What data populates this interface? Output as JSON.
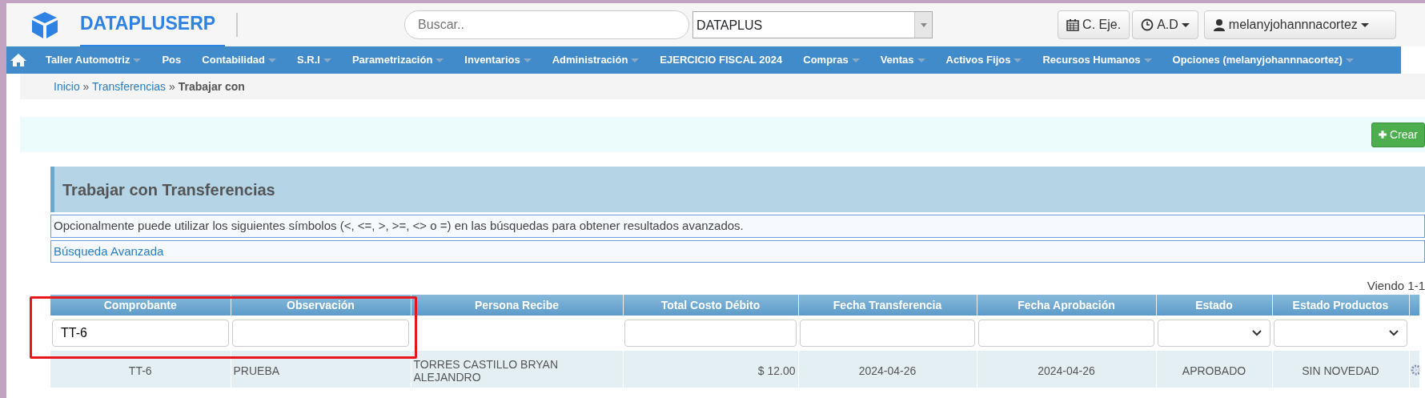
{
  "header": {
    "logo": "DATAPLUSERP",
    "search": {
      "placeholder": "Buscar.."
    },
    "company_select": {
      "value": "DATAPLUS"
    },
    "buttons": [
      {
        "label": "C. Eje.",
        "kind": "calendar",
        "caret": false
      },
      {
        "label": "A.D",
        "kind": "clock",
        "caret": true
      },
      {
        "label": "melanyjohannnacortez",
        "kind": "user",
        "caret": true
      }
    ]
  },
  "menu": [
    {
      "label": "Taller Automotriz",
      "dropdown": true
    },
    {
      "label": "Pos",
      "dropdown": false
    },
    {
      "label": "Contabilidad",
      "dropdown": true
    },
    {
      "label": "S.R.I",
      "dropdown": true
    },
    {
      "label": "Parametrización",
      "dropdown": true
    },
    {
      "label": "Inventarios",
      "dropdown": true
    },
    {
      "label": "Administración",
      "dropdown": true
    },
    {
      "label": "EJERCICIO FISCAL 2024",
      "dropdown": false
    },
    {
      "label": "Compras",
      "dropdown": true
    },
    {
      "label": "Ventas",
      "dropdown": true
    },
    {
      "label": "Activos Fijos",
      "dropdown": true
    },
    {
      "label": "Recursos Humanos",
      "dropdown": true
    },
    {
      "label": "Opciones (melanyjohannnacortez)",
      "dropdown": true
    }
  ],
  "breadcrumb": {
    "separator": "»",
    "items": [
      {
        "label": "Inicio",
        "link": true
      },
      {
        "label": "Transferencias",
        "link": true
      },
      {
        "label": "Trabajar con",
        "link": false
      }
    ]
  },
  "create_button": "Crear",
  "panel": {
    "title": "Trabajar con Transferencias",
    "hint": "Opcionalmente puede utilizar los siguientes símbolos (<, <=, >, >=, <> o =) en las búsquedas para obtener resultados avanzados.",
    "advanced_search": "Búsqueda Avanzada"
  },
  "table": {
    "summary": "Viendo 1-1",
    "columns": [
      "Comprobante",
      "Observación",
      "Persona Recibe",
      "Total Costo Débito",
      "Fecha Transferencia",
      "Fecha Aprobación",
      "Estado",
      "Estado Productos"
    ],
    "filters": [
      {
        "kind": "text",
        "value": "TT-6"
      },
      {
        "kind": "text"
      },
      {
        "kind": "none"
      },
      {
        "kind": "text"
      },
      {
        "kind": "text"
      },
      {
        "kind": "text"
      },
      {
        "kind": "select"
      },
      {
        "kind": "select"
      }
    ],
    "rows": [
      {
        "cells": [
          "TT-6",
          "PRUEBA",
          "TORRES CASTILLO BRYAN ALEJANDRO",
          "$ 12.00",
          "2024-04-26",
          "2024-04-26",
          "APROBADO",
          "SIN NOVEDAD"
        ]
      }
    ]
  },
  "annotation": {
    "kind": "highlight"
  }
}
